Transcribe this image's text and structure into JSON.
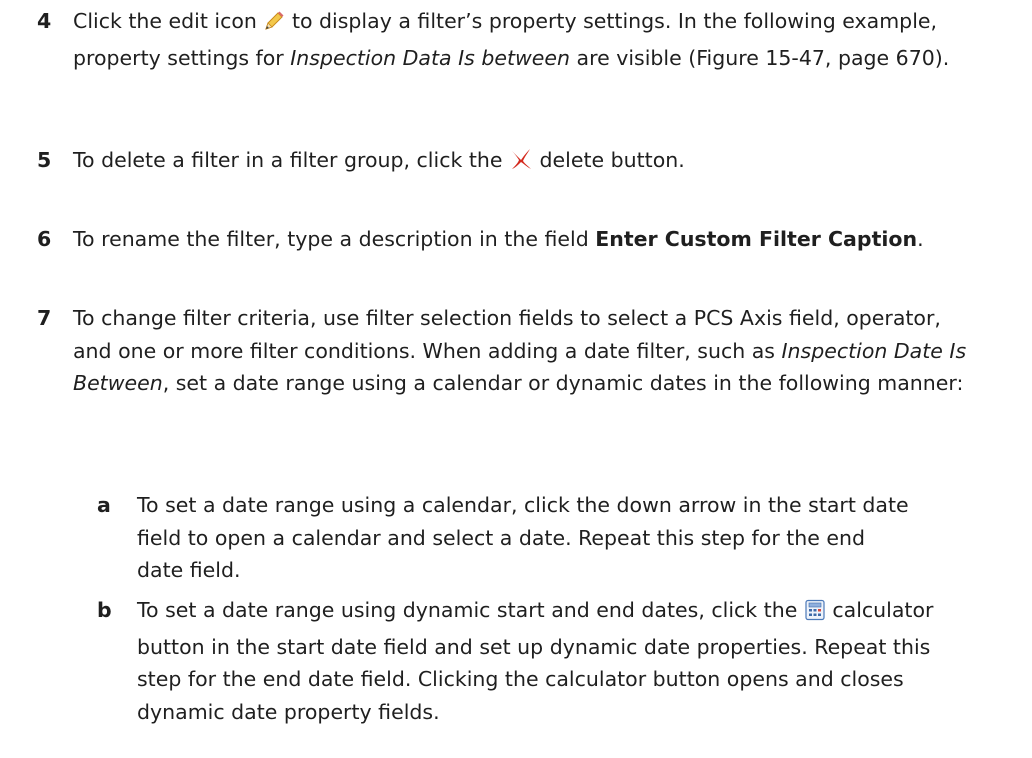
{
  "steps": [
    {
      "number": "4",
      "parts": [
        "Click the edit icon ",
        " to display a filter’s property settings. In the following example, property settings for ",
        "Inspection Data Is between",
        " are visible (Figure 15-47, page 670)."
      ],
      "icon": "pencil-icon"
    },
    {
      "number": "5",
      "parts": [
        "To delete a filter in a filter group, click the ",
        " delete button."
      ],
      "icon": "delete-x-icon"
    },
    {
      "number": "6",
      "parts": [
        "To rename the filter, type a description in the field ",
        "Enter Custom Filter Caption",
        "."
      ]
    },
    {
      "number": "7",
      "parts": [
        "To change filter criteria, use filter selection fields to select a PCS Axis field, operator, and one or more filter conditions. When adding a date filter, such as ",
        "Inspection Date Is Between",
        ", set a date range using a calendar or dynamic dates in the following manner:"
      ],
      "substeps": [
        {
          "letter": "a",
          "text": "To set a date range using a calendar, click the down arrow in the start date field to open a calendar and select a date. Repeat this step for the end date field."
        },
        {
          "letter": "b",
          "parts": [
            "To set a date range using dynamic start and end dates, click the ",
            " calculator button in the start date field and set up dynamic date properties. Repeat this step for the end date field. Clicking the calculator button opens and closes dynamic date property fields."
          ],
          "icon": "calculator-icon"
        }
      ]
    }
  ]
}
